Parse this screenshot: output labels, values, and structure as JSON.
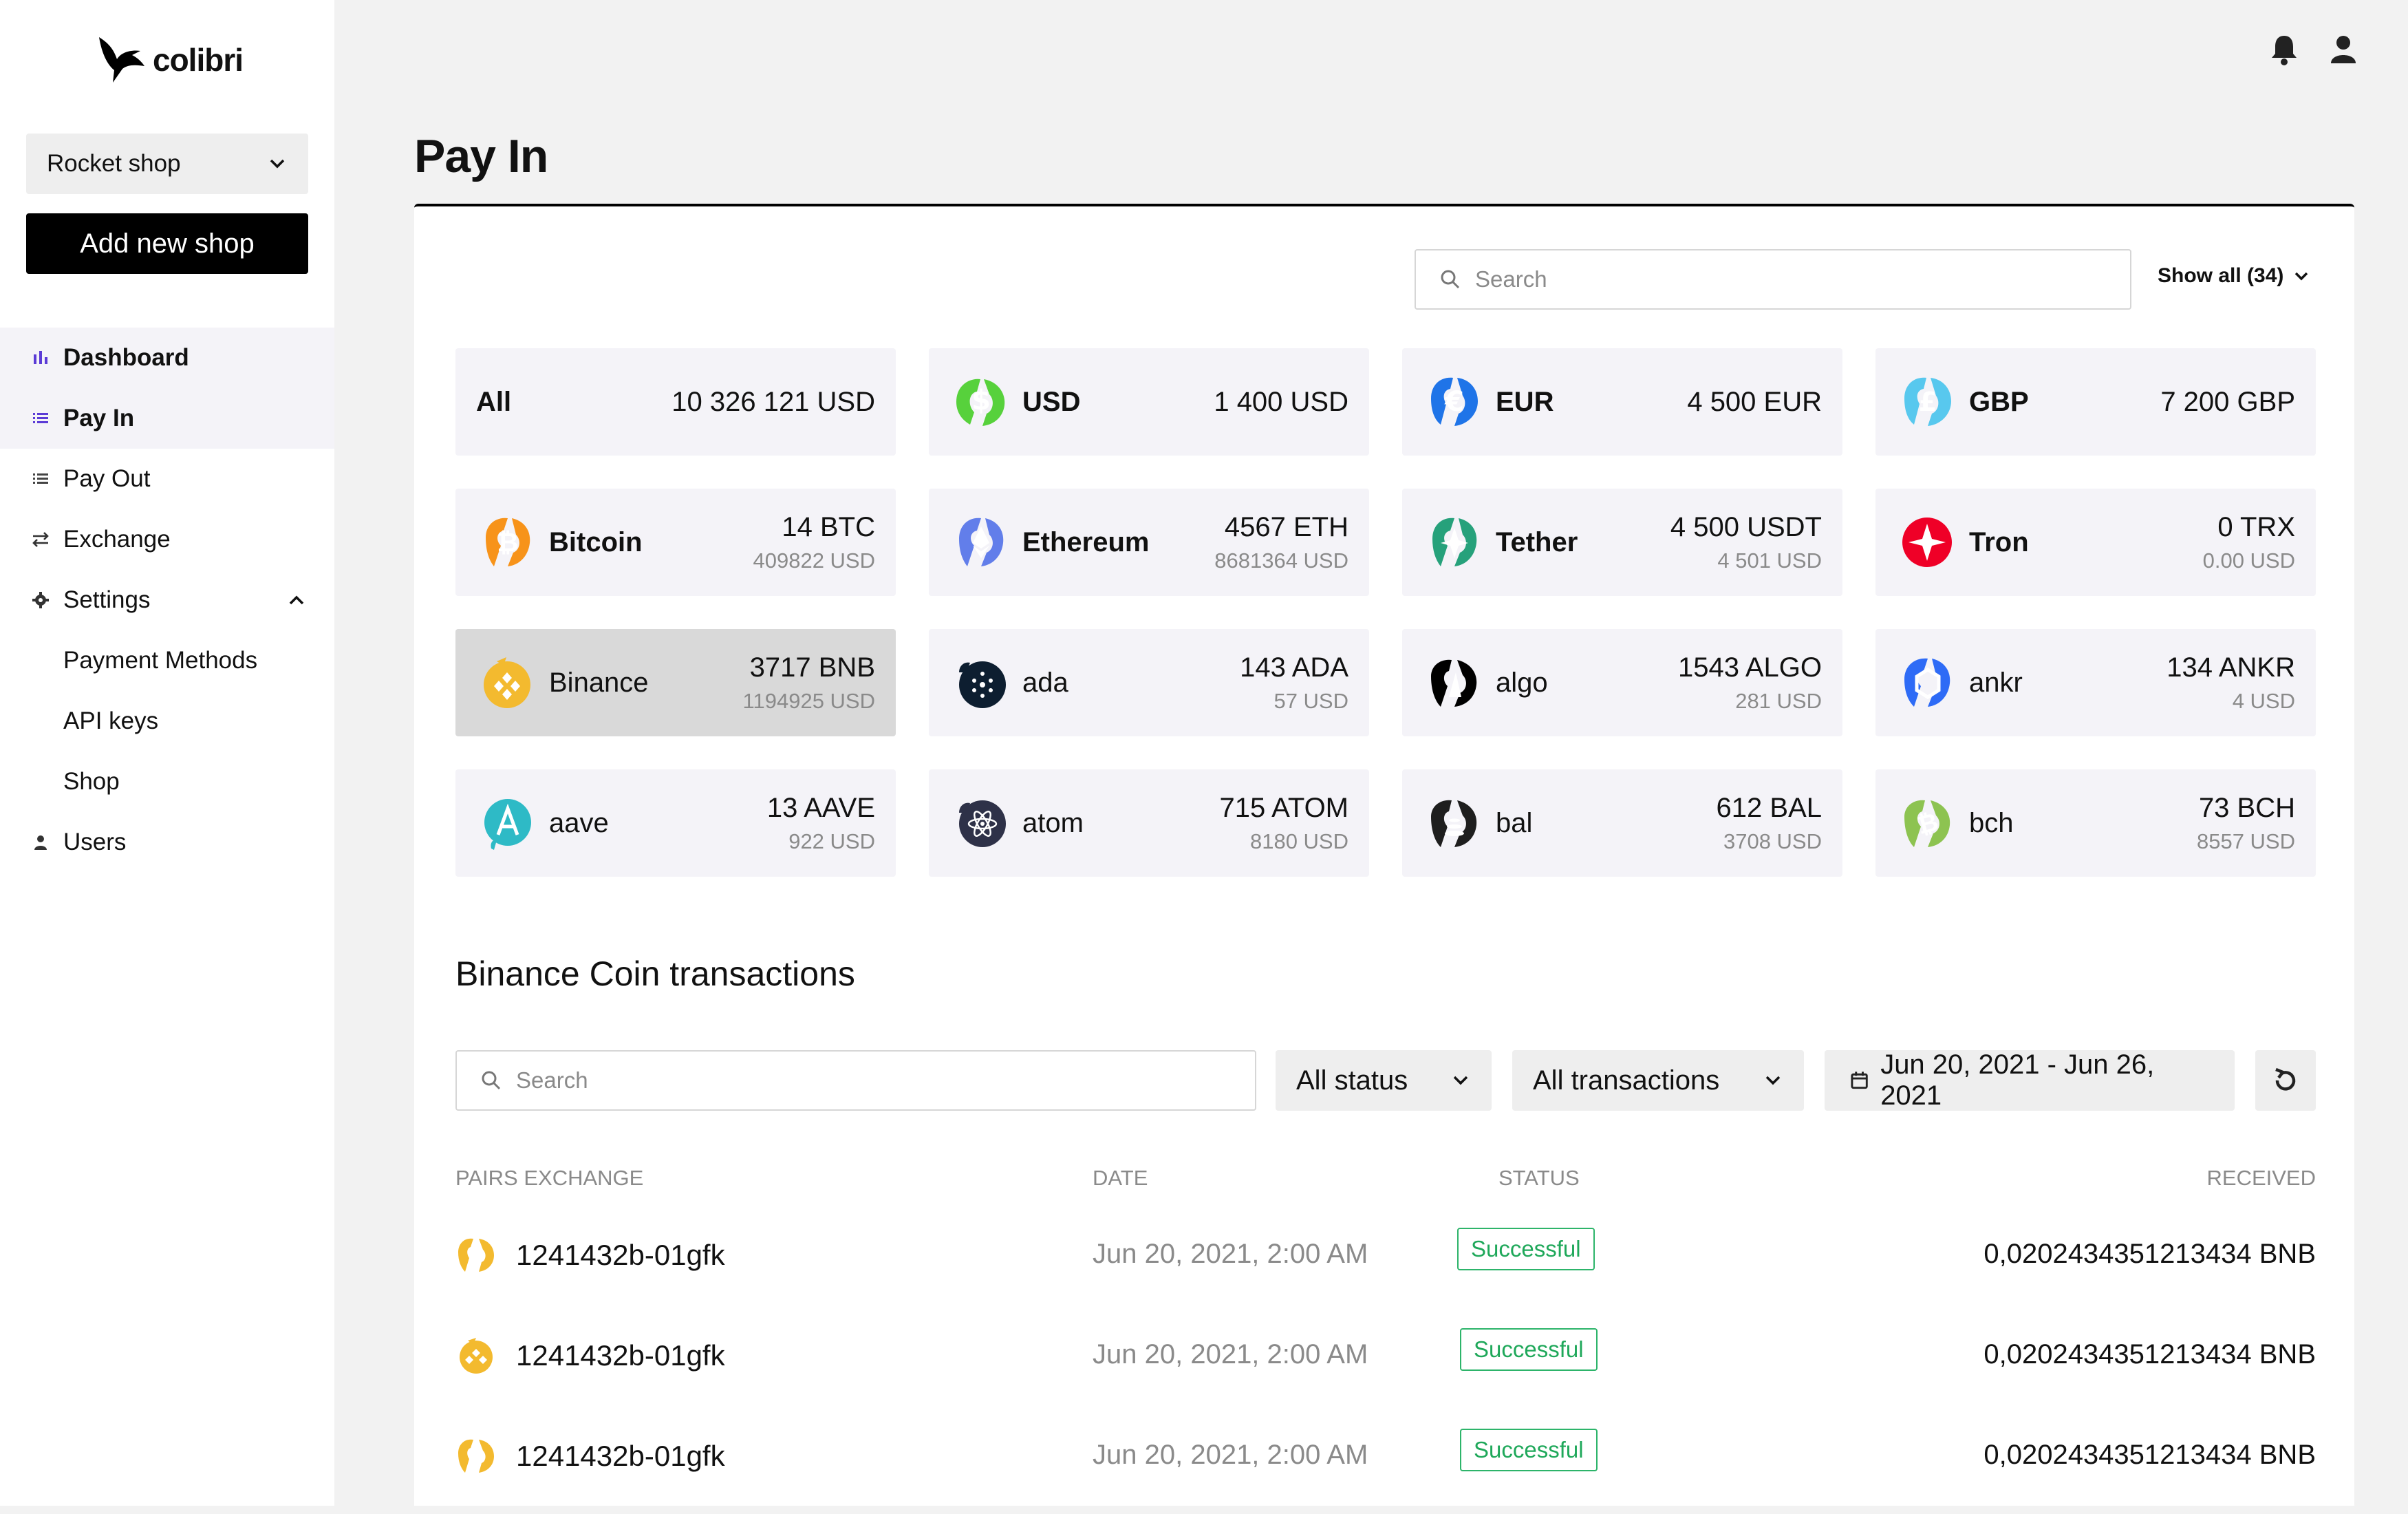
{
  "app": {
    "logo_text": "colibri"
  },
  "sidebar": {
    "shop_select": "Rocket shop",
    "add_shop": "Add new shop",
    "items": [
      {
        "label": "Dashboard",
        "icon": "bar-chart-icon"
      },
      {
        "label": "Pay In",
        "icon": "list-icon"
      },
      {
        "label": "Pay Out",
        "icon": "list-icon"
      },
      {
        "label": "Exchange",
        "icon": "exchange-icon"
      },
      {
        "label": "Settings",
        "icon": "gear-icon"
      },
      {
        "label": "Payment Methods"
      },
      {
        "label": "API keys"
      },
      {
        "label": "Shop"
      },
      {
        "label": "Users",
        "icon": "user-icon"
      }
    ]
  },
  "page": {
    "title": "Pay In"
  },
  "balances": {
    "search_placeholder": "Search",
    "show_all": "Show all (34)",
    "tiles": [
      {
        "name": "All",
        "value": "10 326 121 USD"
      },
      {
        "name": "USD",
        "value": "1 400 USD",
        "color": "#57d13c"
      },
      {
        "name": "EUR",
        "value": "4 500 EUR",
        "color": "#1f74e8"
      },
      {
        "name": "GBP",
        "value": "7 200 GBP",
        "color": "#58c8ee"
      },
      {
        "name": "Bitcoin",
        "value": "14 BTC",
        "sub": "409822 USD",
        "color": "#f7931a"
      },
      {
        "name": "Ethereum",
        "value": "4567 ETH",
        "sub": "8681364 USD",
        "color": "#627eea"
      },
      {
        "name": "Tether",
        "value": "4 500 USDT",
        "sub": "4 501 USD",
        "color": "#26a17b"
      },
      {
        "name": "Tron",
        "value": "0 TRX",
        "sub": "0.00 USD",
        "color": "#ef0027"
      },
      {
        "name": "Binance",
        "value": "3717 BNB",
        "sub": "1194925 USD",
        "color": "#f3ba2f"
      },
      {
        "name": "ada",
        "value": "143 ADA",
        "sub": "57 USD",
        "color": "#0d1e30"
      },
      {
        "name": "algo",
        "value": "1543 ALGO",
        "sub": "281 USD",
        "color": "#000000"
      },
      {
        "name": "ankr",
        "value": "134 ANKR",
        "sub": "4 USD",
        "color": "#2e6bf6"
      },
      {
        "name": "aave",
        "value": "13 AAVE",
        "sub": "922 USD",
        "color": "#2ebac6"
      },
      {
        "name": "atom",
        "value": "715 ATOM",
        "sub": "8180 USD",
        "color": "#2e3148"
      },
      {
        "name": "bal",
        "value": "612 BAL",
        "sub": "3708 USD",
        "color": "#1e1e1e"
      },
      {
        "name": "bch",
        "value": "73 BCH",
        "sub": "8557 USD",
        "color": "#8dc351"
      }
    ]
  },
  "transactions": {
    "title": "Binance Coin transactions",
    "search_placeholder": "Search",
    "status_filter": "All status",
    "type_filter": "All transactions",
    "date_range": "Jun 20, 2021 - Jun 26, 2021",
    "columns": [
      "PAIRS EXCHANGE",
      "DATE",
      "STATUS",
      "RECEIVED"
    ],
    "rows": [
      {
        "pair": "1241432b-01gfk",
        "date": "Jun 20, 2021, 2:00 AM",
        "status": "Successful",
        "received": "0,0202434351213434 BNB"
      },
      {
        "pair": "1241432b-01gfk",
        "date": "Jun 20, 2021, 2:00 AM",
        "status": "Successful",
        "received": "0,0202434351213434 BNB"
      },
      {
        "pair": "1241432b-01gfk",
        "date": "Jun 20, 2021, 2:00 AM",
        "status": "Successful",
        "received": "0,0202434351213434 BNB"
      }
    ]
  }
}
